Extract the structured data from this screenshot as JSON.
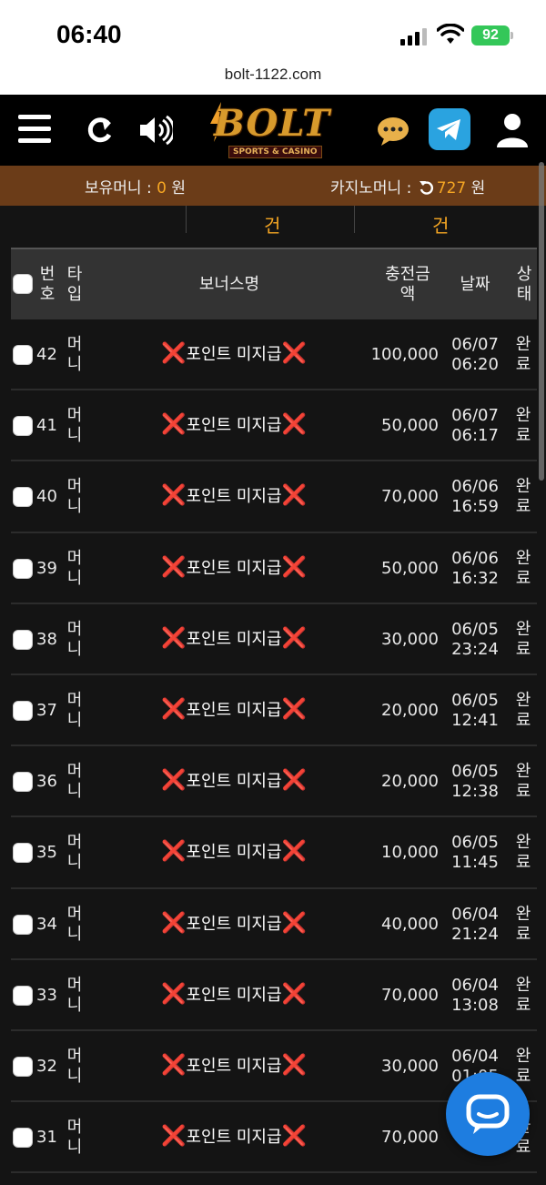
{
  "status_bar": {
    "time": "06:40",
    "battery": "92"
  },
  "browser": {
    "url": "bolt-1122.com"
  },
  "header": {
    "logo_text": "BOLT",
    "logo_sub": "SPORTS & CASINO"
  },
  "money": {
    "held_label": "보유머니 : ",
    "held_value": "0",
    "held_unit": " 원",
    "casino_label": "카지노머니 : ",
    "casino_value": "727",
    "casino_unit": " 원"
  },
  "summary": {
    "col2": "건",
    "col3": "건"
  },
  "table": {
    "headers": {
      "number": "번호",
      "type": "타입",
      "bonus_name": "보너스명",
      "amount": "충전금액",
      "date": "날짜",
      "status": "상태"
    },
    "rows": [
      {
        "num": "42",
        "type": "머니",
        "name": "포인트 미지급",
        "amount": "100,000",
        "date1": "06/07",
        "date2": "06:20",
        "status": "완료"
      },
      {
        "num": "41",
        "type": "머니",
        "name": "포인트 미지급",
        "amount": "50,000",
        "date1": "06/07",
        "date2": "06:17",
        "status": "완료"
      },
      {
        "num": "40",
        "type": "머니",
        "name": "포인트 미지급",
        "amount": "70,000",
        "date1": "06/06",
        "date2": "16:59",
        "status": "완료"
      },
      {
        "num": "39",
        "type": "머니",
        "name": "포인트 미지급",
        "amount": "50,000",
        "date1": "06/06",
        "date2": "16:32",
        "status": "완료"
      },
      {
        "num": "38",
        "type": "머니",
        "name": "포인트 미지급",
        "amount": "30,000",
        "date1": "06/05",
        "date2": "23:24",
        "status": "완료"
      },
      {
        "num": "37",
        "type": "머니",
        "name": "포인트 미지급",
        "amount": "20,000",
        "date1": "06/05",
        "date2": "12:41",
        "status": "완료"
      },
      {
        "num": "36",
        "type": "머니",
        "name": "포인트 미지급",
        "amount": "20,000",
        "date1": "06/05",
        "date2": "12:38",
        "status": "완료"
      },
      {
        "num": "35",
        "type": "머니",
        "name": "포인트 미지급",
        "amount": "10,000",
        "date1": "06/05",
        "date2": "11:45",
        "status": "완료"
      },
      {
        "num": "34",
        "type": "머니",
        "name": "포인트 미지급",
        "amount": "40,000",
        "date1": "06/04",
        "date2": "21:24",
        "status": "완료"
      },
      {
        "num": "33",
        "type": "머니",
        "name": "포인트 미지급",
        "amount": "70,000",
        "date1": "06/04",
        "date2": "13:08",
        "status": "완료"
      },
      {
        "num": "32",
        "type": "머니",
        "name": "포인트 미지급",
        "amount": "30,000",
        "date1": "06/04",
        "date2": "01:05",
        "status": "완료"
      },
      {
        "num": "31",
        "type": "머니",
        "name": "포인트 미지급",
        "amount": "70,000",
        "date1": "06/03",
        "date2": "",
        "status": "완료"
      }
    ]
  },
  "colors": {
    "accent_orange": "#f5a623",
    "money_bar": "#6b3c18",
    "x_mark_red": "#e02020",
    "chat_blue": "#1e7de0",
    "telegram_blue": "#2aa3e0"
  },
  "icons": [
    "hamburger-icon",
    "refresh-icon",
    "speaker-icon",
    "chat-bubble-icon",
    "telegram-icon",
    "user-icon",
    "cross-mark-icon",
    "live-chat-icon"
  ]
}
